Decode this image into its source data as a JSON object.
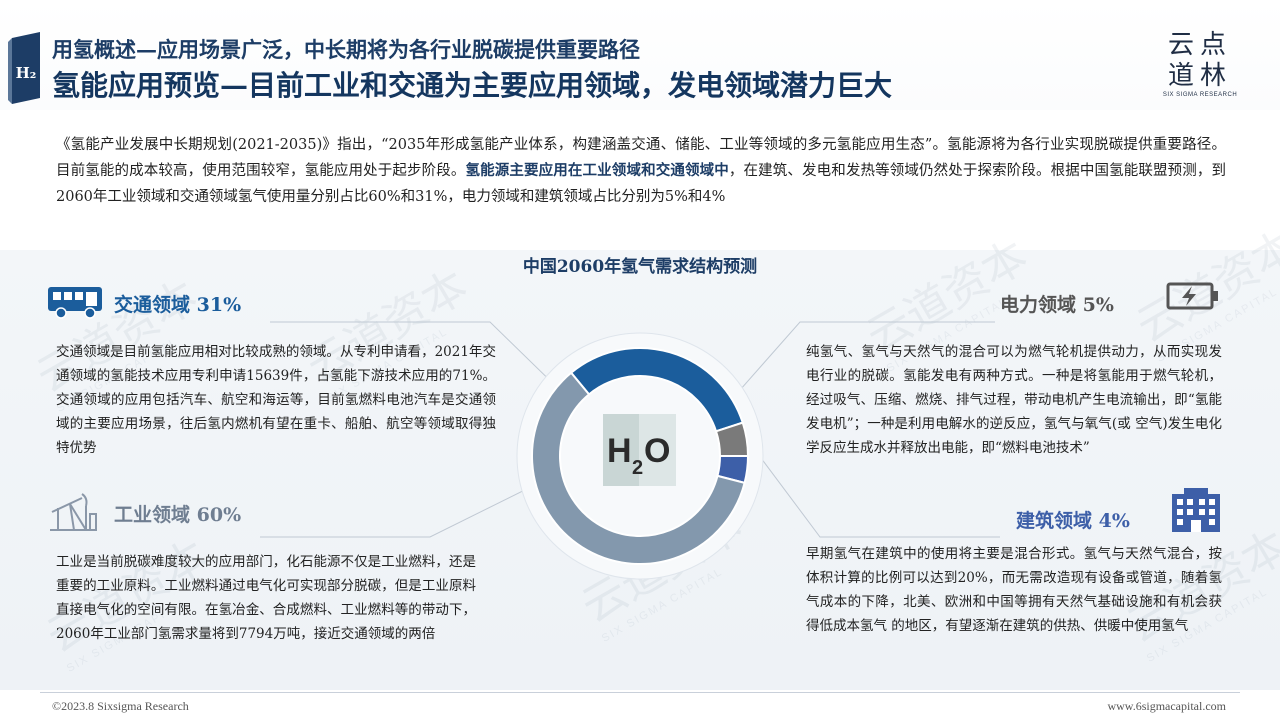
{
  "header": {
    "title_line1": "用氢概述—应用场景广泛，中长期将为各行业脱碳提供重要路径",
    "title_line2": "氢能应用预览—目前工业和交通为主要应用领域，发电领域潜力巨大",
    "icon_text": "H₂",
    "logo_line1": "云点",
    "logo_line2": "道林",
    "logo_sub": "SIX SIGMA RESEARCH"
  },
  "intro": {
    "part1": "《氢能产业发展中长期规划(2021-2035)》指出，“2035年形成氢能产业体系，构建涵盖交通、储能、工业等领域的多元氢能应用生态”。氢能源将为各行业实现脱碳提供重要路径。目前氢能的成本较高，使用范围较窄，氢能应用处于起步阶段。",
    "highlight": "氢能源主要应用在工业领域和交通领域中",
    "part2": "，在建筑、发电和发热等领域仍然处于探索阶段。根据中国氢能联盟预测，到2060年工业领域和交通领域氢气使用量分别占比60%和31%，电力领域和建筑领域占比分别为5%和4%"
  },
  "chart_data": {
    "type": "pie",
    "title": "中国2060年氢气需求结构预测",
    "center_label": "H2O",
    "slices": [
      {
        "name": "交通领域",
        "value": 31,
        "color": "#1b5d9c"
      },
      {
        "name": "电力领域",
        "value": 5,
        "color": "#7a7a7a"
      },
      {
        "name": "建筑领域",
        "value": 4,
        "color": "#3d5fa8"
      },
      {
        "name": "工业领域",
        "value": 60,
        "color": "#8398ad"
      }
    ]
  },
  "sections": {
    "transport": {
      "title": "交通领域",
      "pct": "31%",
      "body": "交通领域是目前氢能应用相对比较成熟的领域。从专利申请看，2021年交通领域的氢能技术应用专利申请15639件，占氢能下游技术应用的71%。交通领域的应用包括汽车、航空和海运等，目前氢燃料电池汽车是交通领域的主要应用场景，往后氢内燃机有望在重卡、船舶、航空等领域取得独特优势"
    },
    "industry": {
      "title": "工业领域",
      "pct": "60%",
      "body": "工业是当前脱碳难度较大的应用部门，化石能源不仅是工业燃料，还是重要的工业原料。工业燃料通过电气化可实现部分脱碳，但是工业原料直接电气化的空间有限。在氢冶金、合成燃料、工业燃料等的带动下，2060年工业部门氢需求量将到7794万吨，接近交通领域的两倍"
    },
    "power": {
      "title": "电力领域",
      "pct": "5%",
      "body": "纯氢气、氢气与天然气的混合可以为燃气轮机提供动力，从而实现发电行业的脱碳。氢能发电有两种方式。一种是将氢能用于燃气轮机，经过吸气、压缩、燃烧、排气过程，带动电机产生电流输出，即“氢能发电机”；一种是利用电解水的逆反应，氢气与氧气(或 空气)发生电化学反应生成水并释放出电能，即“燃料电池技术”"
    },
    "building": {
      "title": "建筑领域",
      "pct": "4%",
      "body": "早期氢气在建筑中的使用将主要是混合形式。氢气与天然气混合，按体积计算的比例可以达到20%，而无需改造现有设备或管道，随着氢气成本的下降，北美、欧洲和中国等拥有天然气基础设施和有机会获得低成本氢气 的地区，有望逐渐在建筑的供热、供暖中使用氢气"
    }
  },
  "watermark": {
    "main": "云道资本",
    "sub": "SIX SIGMA CAPITAL"
  },
  "footer": {
    "left": "©2023.8 Sixsigma Research",
    "right": "www.6sigmacapital.com"
  },
  "colors": {
    "navy": "#1d3d66",
    "transport_blue": "#1b5d9c",
    "industry_gray": "#8398ad",
    "power_gray": "#7a7a7a",
    "building_blue": "#3d5fa8"
  },
  "icons": {
    "transport": "bus-icon",
    "industry": "pumpjack-icon",
    "power": "battery-charging-icon",
    "building": "building-icon"
  }
}
